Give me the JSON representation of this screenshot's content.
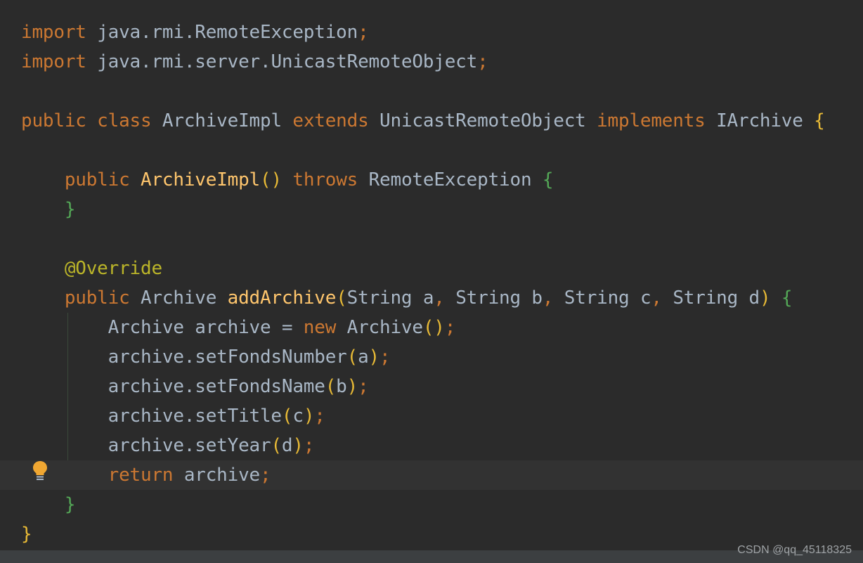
{
  "editor": {
    "lines": [
      {
        "id": "line-1",
        "tokens": [
          {
            "c": "kw",
            "t": "import"
          },
          {
            "c": "id",
            "t": " java.rmi.RemoteException"
          },
          {
            "c": "pn",
            "t": ";"
          }
        ]
      },
      {
        "id": "line-2",
        "tokens": [
          {
            "c": "kw",
            "t": "import"
          },
          {
            "c": "id",
            "t": " java.rmi.server.UnicastRemoteObject"
          },
          {
            "c": "pn",
            "t": ";"
          }
        ]
      },
      {
        "id": "line-3",
        "tokens": []
      },
      {
        "id": "line-4",
        "tokens": [
          {
            "c": "kw",
            "t": "public class"
          },
          {
            "c": "id",
            "t": " ArchiveImpl "
          },
          {
            "c": "kw",
            "t": "extends"
          },
          {
            "c": "id",
            "t": " UnicastRemoteObject "
          },
          {
            "c": "kw",
            "t": "implements"
          },
          {
            "c": "id",
            "t": " IArchive "
          },
          {
            "c": "p1",
            "t": "{"
          }
        ]
      },
      {
        "id": "line-5",
        "tokens": []
      },
      {
        "id": "line-6",
        "tokens": [
          {
            "c": "kw",
            "t": "    public"
          },
          {
            "c": "id",
            "t": " "
          },
          {
            "c": "fn",
            "t": "ArchiveImpl"
          },
          {
            "c": "p1",
            "t": "()"
          },
          {
            "c": "id",
            "t": " "
          },
          {
            "c": "kw",
            "t": "throws"
          },
          {
            "c": "id",
            "t": " RemoteException "
          },
          {
            "c": "p2",
            "t": "{"
          }
        ]
      },
      {
        "id": "line-7",
        "tokens": [
          {
            "c": "id",
            "t": "    "
          },
          {
            "c": "p2",
            "t": "}"
          }
        ]
      },
      {
        "id": "line-8",
        "tokens": []
      },
      {
        "id": "line-9",
        "tokens": [
          {
            "c": "an",
            "t": "    @Override"
          }
        ]
      },
      {
        "id": "line-10",
        "tokens": [
          {
            "c": "kw",
            "t": "    public"
          },
          {
            "c": "id",
            "t": " Archive "
          },
          {
            "c": "fn",
            "t": "addArchive"
          },
          {
            "c": "p1",
            "t": "("
          },
          {
            "c": "id",
            "t": "String a"
          },
          {
            "c": "pn",
            "t": ","
          },
          {
            "c": "id",
            "t": " String b"
          },
          {
            "c": "pn",
            "t": ","
          },
          {
            "c": "id",
            "t": " String c"
          },
          {
            "c": "pn",
            "t": ","
          },
          {
            "c": "id",
            "t": " String d"
          },
          {
            "c": "p1",
            "t": ")"
          },
          {
            "c": "id",
            "t": " "
          },
          {
            "c": "p2",
            "t": "{"
          }
        ]
      },
      {
        "id": "line-11",
        "tokens": [
          {
            "c": "id",
            "t": "        Archive archive = "
          },
          {
            "c": "kw",
            "t": "new"
          },
          {
            "c": "id",
            "t": " Archive"
          },
          {
            "c": "p1",
            "t": "()"
          },
          {
            "c": "pn",
            "t": ";"
          }
        ]
      },
      {
        "id": "line-12",
        "tokens": [
          {
            "c": "id",
            "t": "        archive.setFondsNumber"
          },
          {
            "c": "p1",
            "t": "("
          },
          {
            "c": "id",
            "t": "a"
          },
          {
            "c": "p1",
            "t": ")"
          },
          {
            "c": "pn",
            "t": ";"
          }
        ]
      },
      {
        "id": "line-13",
        "tokens": [
          {
            "c": "id",
            "t": "        archive.setFondsName"
          },
          {
            "c": "p1",
            "t": "("
          },
          {
            "c": "id",
            "t": "b"
          },
          {
            "c": "p1",
            "t": ")"
          },
          {
            "c": "pn",
            "t": ";"
          }
        ]
      },
      {
        "id": "line-14",
        "tokens": [
          {
            "c": "id",
            "t": "        archive.setTitle"
          },
          {
            "c": "p1",
            "t": "("
          },
          {
            "c": "id",
            "t": "c"
          },
          {
            "c": "p1",
            "t": ")"
          },
          {
            "c": "pn",
            "t": ";"
          }
        ]
      },
      {
        "id": "line-15",
        "tokens": [
          {
            "c": "id",
            "t": "        archive.setYear"
          },
          {
            "c": "p1",
            "t": "("
          },
          {
            "c": "id",
            "t": "d"
          },
          {
            "c": "p1",
            "t": ")"
          },
          {
            "c": "pn",
            "t": ";"
          }
        ]
      },
      {
        "id": "line-16",
        "current": true,
        "tokens": [
          {
            "c": "kw",
            "t": "        return"
          },
          {
            "c": "id",
            "t": " archive"
          },
          {
            "c": "pn",
            "t": ";"
          }
        ]
      },
      {
        "id": "line-17",
        "tokens": [
          {
            "c": "id",
            "t": "    "
          },
          {
            "c": "p2",
            "t": "}"
          }
        ]
      },
      {
        "id": "line-18",
        "tokens": [
          {
            "c": "p1",
            "t": "}"
          }
        ]
      }
    ]
  },
  "gutter": {
    "intention_icon": "lightbulb-icon",
    "intention_color": "#f0a732"
  },
  "watermark": "CSDN @qq_45118325",
  "colors": {
    "background": "#2b2b2b",
    "current_line": "#323232",
    "keyword": "#cc7832",
    "identifier": "#a9b7c6",
    "method": "#ffc66d",
    "annotation": "#bbb529",
    "bracket_level_1": "#e8ba36",
    "bracket_level_2": "#54a857"
  }
}
